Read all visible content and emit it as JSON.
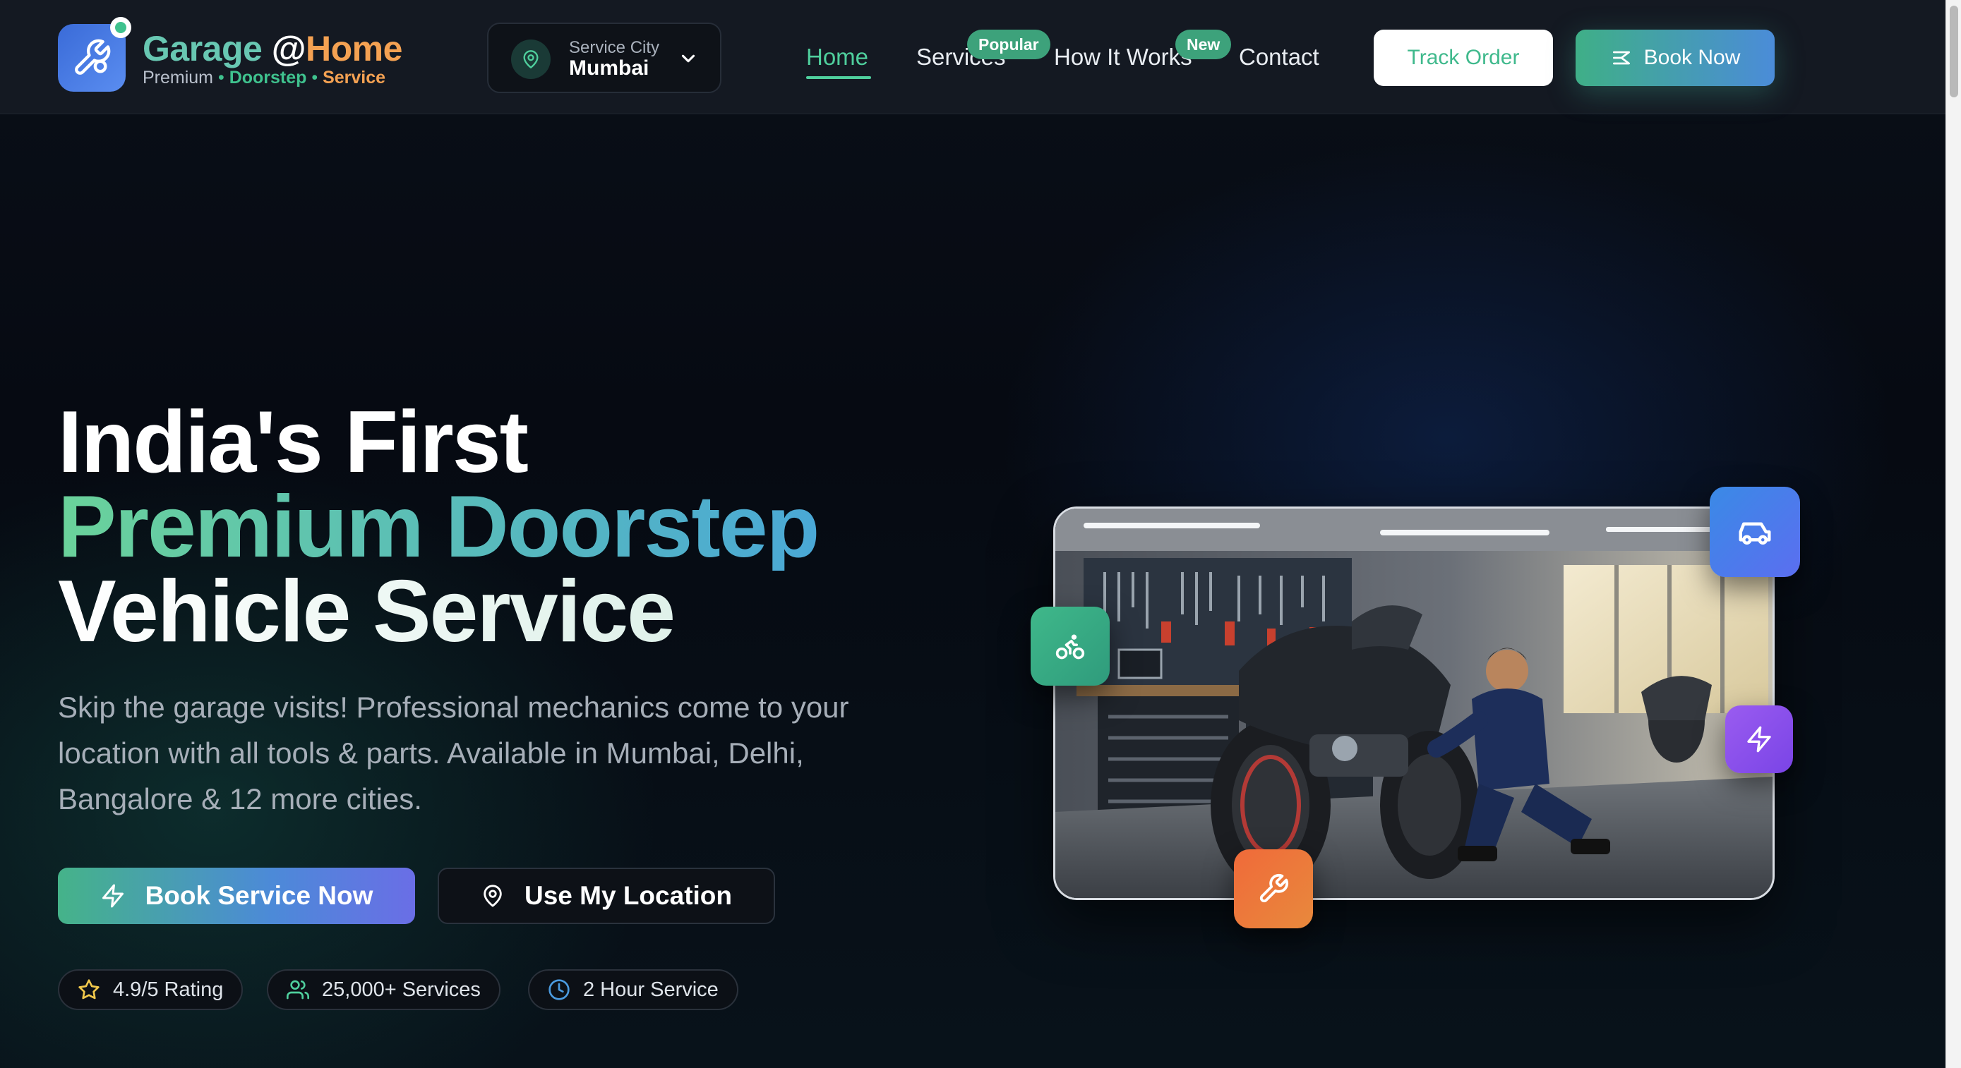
{
  "header": {
    "brand": {
      "part1": "Garage",
      "at": "@",
      "part2": "Home"
    },
    "tagline": {
      "premium": "Premium",
      "sep": "•",
      "doorstep": "Doorstep",
      "service": "Service"
    },
    "city_selector": {
      "label": "Service City",
      "value": "Mumbai"
    },
    "nav": [
      {
        "label": "Home",
        "active": true
      },
      {
        "label": "Services",
        "badge": "Popular"
      },
      {
        "label": "How It Works",
        "badge": "New"
      },
      {
        "label": "Contact"
      }
    ],
    "track_order": "Track Order",
    "book_now": "Book Now"
  },
  "hero": {
    "line1": "India's First",
    "line2": "Premium Doorstep",
    "line3": "Vehicle Service",
    "description": "Skip the garage visits! Professional mechanics come to your location with all tools & parts. Available in Mumbai, Delhi, Bangalore & 12 more cities.",
    "primary_cta": "Book Service Now",
    "secondary_cta": "Use My Location",
    "stats": [
      {
        "icon": "star-icon",
        "label": "4.9/5 Rating"
      },
      {
        "icon": "users-icon",
        "label": "25,000+ Services"
      },
      {
        "icon": "clock-icon",
        "label": "2 Hour Service"
      }
    ]
  },
  "colors": {
    "accent_green": "#4fcf9d",
    "accent_blue": "#4b8cd8",
    "accent_orange": "#f4a152",
    "background": "#06090f"
  }
}
